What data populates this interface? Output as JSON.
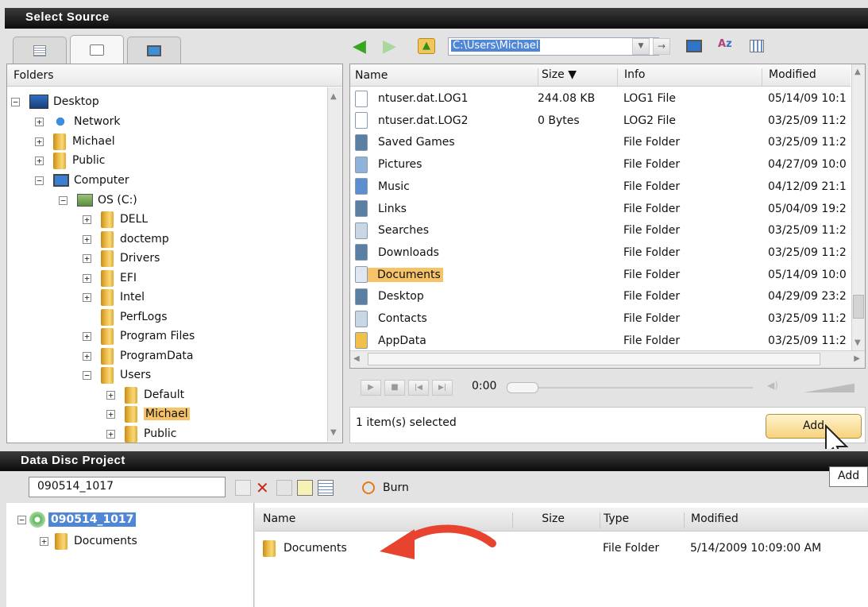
{
  "select_source": {
    "title": "Select Source",
    "tabs": [
      "list-view-icon",
      "folder-tab-icon",
      "computer-tab-icon"
    ],
    "folders_label": "Folders",
    "tree": [
      {
        "label": "Desktop",
        "icon": "desktop-icon",
        "exp": "−"
      },
      {
        "label": "Network",
        "icon": "network-icon",
        "exp": "+"
      },
      {
        "label": "Michael",
        "icon": "folder-icon",
        "exp": "+"
      },
      {
        "label": "Public",
        "icon": "folder-icon",
        "exp": "+"
      },
      {
        "label": "Computer",
        "icon": "computer-icon",
        "exp": "−"
      },
      {
        "label": "OS (C:)",
        "icon": "drive-icon",
        "exp": "−"
      },
      {
        "label": "DELL",
        "icon": "folder-icon",
        "exp": "+"
      },
      {
        "label": "doctemp",
        "icon": "folder-icon",
        "exp": "+"
      },
      {
        "label": "Drivers",
        "icon": "folder-icon",
        "exp": "+"
      },
      {
        "label": "EFI",
        "icon": "folder-icon",
        "exp": "+"
      },
      {
        "label": "Intel",
        "icon": "folder-icon",
        "exp": "+"
      },
      {
        "label": "PerfLogs",
        "icon": "folder-icon",
        "exp": ""
      },
      {
        "label": "Program Files",
        "icon": "folder-icon",
        "exp": "+"
      },
      {
        "label": "ProgramData",
        "icon": "folder-icon",
        "exp": "+"
      },
      {
        "label": "Users",
        "icon": "folder-icon",
        "exp": "−"
      },
      {
        "label": "Default",
        "icon": "folder-icon",
        "exp": "+"
      },
      {
        "label": "Michael",
        "icon": "folder-icon",
        "exp": "+",
        "selected": true
      },
      {
        "label": "Public",
        "icon": "folder-icon",
        "exp": "+"
      }
    ],
    "path": "C:\\Users\\Michael",
    "columns": {
      "name": "Name",
      "size": "Size ▼",
      "info": "Info",
      "modified": "Modified"
    },
    "files": [
      {
        "name": "ntuser.dat.LOG1",
        "size": "244.08 KB",
        "info": "LOG1 File",
        "modified": "05/14/09 10:1",
        "icon": "document-icon"
      },
      {
        "name": "ntuser.dat.LOG2",
        "size": "0 Bytes",
        "info": "LOG2 File",
        "modified": "03/25/09 11:2",
        "icon": "document-icon"
      },
      {
        "name": "Saved Games",
        "size": "",
        "info": "File Folder",
        "modified": "03/25/09 11:2",
        "icon": "saved-games-icon"
      },
      {
        "name": "Pictures",
        "size": "",
        "info": "File Folder",
        "modified": "04/27/09 10:0",
        "icon": "pictures-icon"
      },
      {
        "name": "Music",
        "size": "",
        "info": "File Folder",
        "modified": "04/12/09 21:1",
        "icon": "music-icon"
      },
      {
        "name": "Links",
        "size": "",
        "info": "File Folder",
        "modified": "05/04/09 19:2",
        "icon": "links-icon"
      },
      {
        "name": "Searches",
        "size": "",
        "info": "File Folder",
        "modified": "03/25/09 11:2",
        "icon": "searches-icon"
      },
      {
        "name": "Downloads",
        "size": "",
        "info": "File Folder",
        "modified": "03/25/09 11:2",
        "icon": "downloads-icon"
      },
      {
        "name": "Documents",
        "size": "",
        "info": "File Folder",
        "modified": "05/14/09 10:0",
        "icon": "documents-icon",
        "selected": true
      },
      {
        "name": "Desktop",
        "size": "",
        "info": "File Folder",
        "modified": "04/29/09 23:2",
        "icon": "desktop-folder-icon"
      },
      {
        "name": "Contacts",
        "size": "",
        "info": "File Folder",
        "modified": "03/25/09 11:2",
        "icon": "contacts-icon"
      },
      {
        "name": "AppData",
        "size": "",
        "info": "File Folder",
        "modified": "03/25/09 11:2",
        "icon": "folder-icon"
      }
    ],
    "player_time": "0:00",
    "status": "1 item(s) selected",
    "add_button": "Add",
    "tooltip": "Add"
  },
  "project": {
    "title": "Data Disc Project",
    "name_value": "090514_1017",
    "burn_label": "Burn",
    "tree_root": "090514_1017",
    "tree_child": "Documents",
    "columns": {
      "name": "Name",
      "size": "Size",
      "type": "Type",
      "modified": "Modified"
    },
    "rows": [
      {
        "name": "Documents",
        "size": "",
        "type": "File Folder",
        "modified": "5/14/2009 10:09:00 AM"
      }
    ]
  },
  "colors": {
    "selection": "#f7c368",
    "accent_arrow": "#e8432e",
    "header_bar": "#1b1b1b"
  }
}
